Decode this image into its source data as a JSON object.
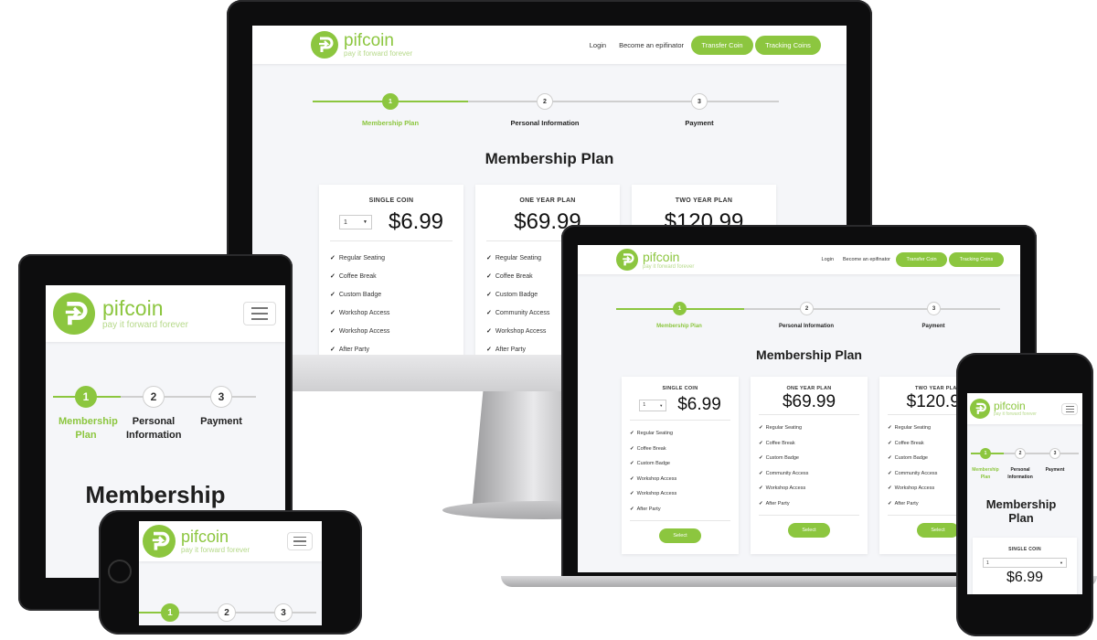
{
  "brand": {
    "name": "pifcoin",
    "tagline": "pay it forward forever",
    "accent": "#8cc63f"
  },
  "nav": {
    "login": "Login",
    "become": "Become an epifinator",
    "transfer": "Transfer Coin",
    "tracking": "Tracking Coins"
  },
  "steps": [
    {
      "number": "1",
      "label": "Membership Plan",
      "active": true
    },
    {
      "number": "2",
      "label": "Personal Information",
      "active": false
    },
    {
      "number": "3",
      "label": "Payment",
      "active": false
    }
  ],
  "page_title": "Membership Plan",
  "plans": [
    {
      "title": "SINGLE COIN",
      "qty": "1",
      "price": "$6.99",
      "features": [
        "Regular Seating",
        "Coffee Break",
        "Custom Badge",
        "Workshop Access",
        "Workshop Access",
        "After Party"
      ],
      "select": "Select"
    },
    {
      "title": "ONE YEAR PLAN",
      "price": "$69.99",
      "features": [
        "Regular Seating",
        "Coffee Break",
        "Custom Badge",
        "Community Access",
        "Workshop Access",
        "After Party"
      ],
      "select": "Select"
    },
    {
      "title": "TWO YEAR PLAN",
      "price": "$120.99",
      "features": [
        "Regular Seating",
        "Coffee Break",
        "Custom Badge",
        "Community Access",
        "Workshop Access",
        "After Party"
      ],
      "select": "Select"
    }
  ],
  "tablet": {
    "title_partial": "Membership"
  },
  "icons": {
    "logo": "pifcoin-logo-icon",
    "check": "check-icon",
    "menu": "hamburger-icon",
    "dropdown": "caret-down-icon"
  }
}
